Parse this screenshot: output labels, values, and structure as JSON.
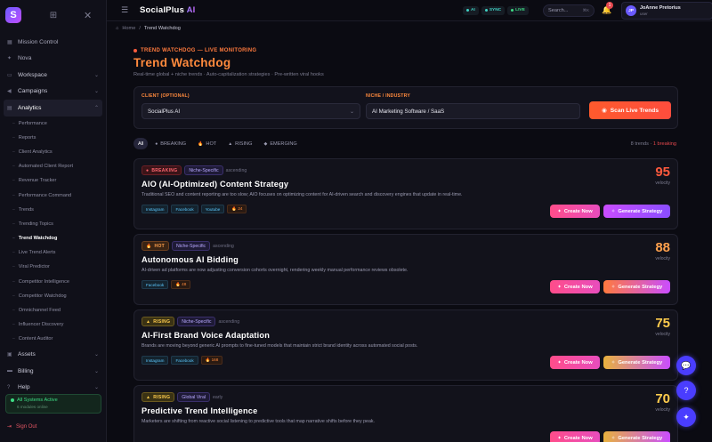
{
  "sidebar": {
    "logo_letter": "S",
    "items": [
      {
        "label": "Mission Control",
        "icon": "grid-icon",
        "type": "item"
      },
      {
        "label": "Nova",
        "icon": "sparkle-icon",
        "type": "item"
      },
      {
        "label": "Workspace",
        "icon": "folder-icon",
        "type": "section"
      },
      {
        "label": "Campaigns",
        "icon": "megaphone-icon",
        "type": "section"
      },
      {
        "label": "Analytics",
        "icon": "chart-icon",
        "type": "section-open"
      }
    ],
    "analytics_sub": [
      "Performance",
      "Reports",
      "Client Analytics",
      "Automated Client Report",
      "Revenue Tracker",
      "Performance Command",
      "Trends",
      "Trending Topics",
      "Trend Watchdog",
      "Live Trend Alerts",
      "Viral Predictor",
      "Competitor Intelligence",
      "Competitor Watchdog",
      "Omnichannel Feed",
      "Influencer Discovery",
      "Content Auditor"
    ],
    "active_sub": "Trend Watchdog",
    "bottom_items": [
      {
        "label": "Assets",
        "icon": "image-icon"
      },
      {
        "label": "Billing",
        "icon": "card-icon"
      },
      {
        "label": "Help",
        "icon": "help-icon"
      }
    ],
    "status": {
      "title": "All Systems Active",
      "sub": "6 modules online"
    },
    "signout": "Sign Out"
  },
  "topbar": {
    "brand": "SocialPlus",
    "brand_ai": "AI",
    "pills": [
      "AI",
      "SYNC",
      "LIVE"
    ],
    "search_placeholder": "Search...",
    "search_kbd": "⌘K",
    "notif_count": "1",
    "user": {
      "initials": "JP",
      "name": "JoAnne Pretorius",
      "role": "user"
    }
  },
  "breadcrumb": {
    "home": "Home",
    "current": "Trend Watchdog"
  },
  "header": {
    "eyebrow": "TREND WATCHDOG — LIVE MONITORING",
    "title": "Trend Watchdog",
    "subtitle": "Real-time global + niche trends · Auto-capitalization strategies · Pre-written viral hooks"
  },
  "filters": {
    "client_label": "CLIENT (OPTIONAL)",
    "client_value": "SocialPlus AI",
    "niche_label": "NICHE / INDUSTRY",
    "niche_value": "AI Marketing Software / SaaS",
    "scan_label": "Scan Live Trends"
  },
  "tabs": [
    {
      "label": "All",
      "icon": ""
    },
    {
      "label": "BREAKING",
      "icon": "●"
    },
    {
      "label": "HOT",
      "icon": "🔥"
    },
    {
      "label": "RISING",
      "icon": "▲"
    },
    {
      "label": "EMERGING",
      "icon": "◆"
    }
  ],
  "counts": {
    "trends": "8 trends ·",
    "breaking": "1 breaking"
  },
  "colors": {
    "accent": "#ff8a3d",
    "score_breaking": "#ff5a3d",
    "score_hot": "#ffa14d",
    "score_rising": "#ffcc4d"
  },
  "cards": [
    {
      "level": "BREAKING",
      "level_class": "breaking",
      "level_icon": "●",
      "niche": "Niche-Specific",
      "direction": "ascending",
      "title": "AIO (AI-Optimized) Content Strategy",
      "desc": "Traditional SEO and content reporting are too slow; AIO focuses on optimizing content for AI-driven search and discovery engines that update in real-time.",
      "chips": [
        "Instagram",
        "Facebook",
        "Youtube"
      ],
      "metric": "🔥 24",
      "score": "95",
      "score_label": "velocity",
      "score_color": "#ff5a3d",
      "create": "Create Now",
      "strategy": "Generate Strategy",
      "strategy_class": ""
    },
    {
      "level": "HOT",
      "level_class": "hot",
      "level_icon": "🔥",
      "niche": "Niche-Specific",
      "direction": "ascending",
      "title": "Autonomous AI Bidding",
      "desc": "AI-driven ad platforms are now adjusting conversion cohorts overnight, rendering weekly manual performance reviews obsolete.",
      "chips": [
        "Facebook"
      ],
      "metric": "🔥 48",
      "score": "88",
      "score_label": "velocity",
      "score_color": "#ffa14d",
      "create": "Create Now",
      "strategy": "Generate Strategy",
      "strategy_class": "orange"
    },
    {
      "level": "RISING",
      "level_class": "rising",
      "level_icon": "▲",
      "niche": "Niche-Specific",
      "direction": "ascending",
      "title": "AI-First Brand Voice Adaptation",
      "desc": "Brands are moving beyond generic AI prompts to fine-tuned models that maintain strict brand identity across automated social posts.",
      "chips": [
        "Instagram",
        "Facebook"
      ],
      "metric": "🔥 168",
      "score": "75",
      "score_label": "velocity",
      "score_color": "#ffcc4d",
      "create": "Create Now",
      "strategy": "Generate Strategy",
      "strategy_class": "gold"
    },
    {
      "level": "RISING",
      "level_class": "rising",
      "level_icon": "▲",
      "niche": "Global Viral",
      "direction": "early",
      "title": "Predictive Trend Intelligence",
      "desc": "Marketers are shifting from reactive social listening to predictive tools that map narrative shifts before they peak.",
      "chips": [],
      "metric": "",
      "score": "70",
      "score_label": "velocity",
      "score_color": "#ffcc4d",
      "create": "Create Now",
      "strategy": "Generate Strategy",
      "strategy_class": "gold"
    }
  ],
  "fabs": [
    "chat-icon",
    "help-icon",
    "sparkle-icon"
  ]
}
